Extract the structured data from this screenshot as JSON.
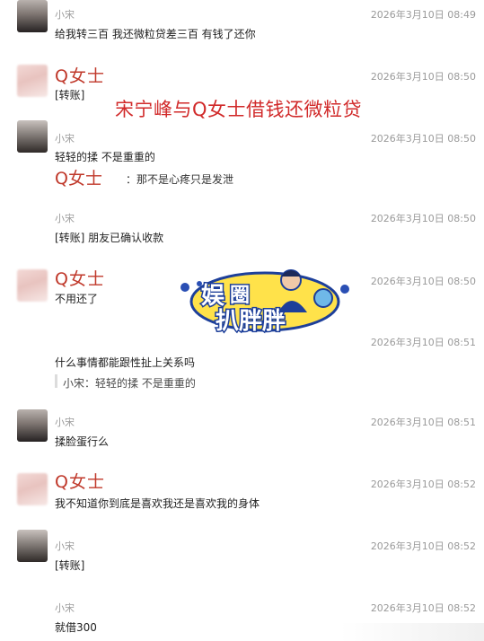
{
  "overlay_title": "宋宁峰与Q女士借钱还微粒贷",
  "inline_reply": {
    "sender": "Q女士",
    "text": "：那不是心疼只是发泄"
  },
  "messages": [
    {
      "sender": "小宋",
      "time": "2026年3月10日 08:49",
      "text": "给我转三百 我还微粒贷差三百 有钱了还你"
    },
    {
      "sender": "Q女士",
      "time": "2026年3月10日 08:50",
      "text": "[转账]"
    },
    {
      "sender": "小宋",
      "time": "2026年3月10日 08:50",
      "text": "轻轻的揉 不是重重的"
    },
    {
      "sender": "小宋",
      "time": "2026年3月10日 08:50",
      "text": "[转账] 朋友已确认收款"
    },
    {
      "sender": "Q女士",
      "time": "2026年3月10日 08:50",
      "text": "不用还了"
    },
    {
      "sender": "",
      "time": "2026年3月10日 08:51",
      "text": "什么事情都能跟性扯上关系吗",
      "quote": "小宋：轻轻的揉 不是重重的"
    },
    {
      "sender": "小宋",
      "time": "2026年3月10日 08:51",
      "text": "揉脸蛋行么"
    },
    {
      "sender": "Q女士",
      "time": "2026年3月10日 08:52",
      "text": "我不知道你到底是喜欢我还是喜欢我的身体"
    },
    {
      "sender": "小宋",
      "time": "2026年3月10日 08:52",
      "text": "[转账]"
    },
    {
      "sender": "小宋",
      "time": "2026年3月10日 08:52",
      "text": "就借300"
    }
  ],
  "watermark_icon": "entertainment-circle-logo",
  "colors": {
    "accent_red": "#d12a2a",
    "muted": "#9a9a9a"
  }
}
